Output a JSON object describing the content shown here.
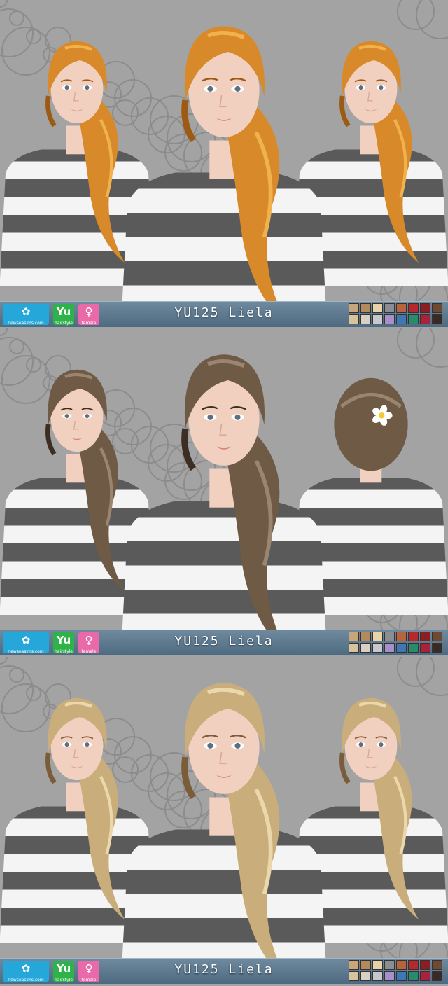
{
  "panels": [
    {
      "title": "YU125 Liela",
      "hair": "#d88a2b",
      "hairLight": "#f0b24c",
      "hairDark": "#9c5a14"
    },
    {
      "title": "YU125 Liela",
      "hair": "#6e5a45",
      "hairLight": "#9a8570",
      "hairDark": "#3c2e22"
    },
    {
      "title": "YU125 Liela",
      "hair": "#c9ad7a",
      "hairLight": "#ead8ac",
      "hairDark": "#7a5c38"
    }
  ],
  "badges": {
    "logo_label": "newseasims.com",
    "yu_glyph": "Yu",
    "yu_label": "hairstyle",
    "female_label": "female"
  },
  "swatch_colors": [
    "#c9a57a",
    "#b38a5e",
    "#e8d3a8",
    "#8a8d92",
    "#b9633a",
    "#b7282c",
    "#8c1d23",
    "#6e4a32",
    "#d8c39a",
    "#d9cfc4",
    "#c8c8cc",
    "#a790c9",
    "#3f77b5",
    "#2b8a6c",
    "#a8233a",
    "#3a2a26"
  ],
  "colors": {
    "shirt_dark": "#5a5a5a",
    "shirt_light": "#f4f4f4",
    "skin": "#f2d0bf",
    "bg_pattern": "#a3a3a3"
  }
}
